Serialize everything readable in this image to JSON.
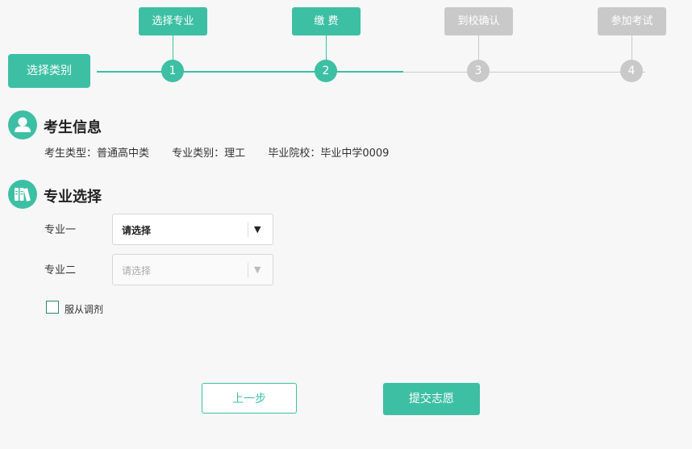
{
  "stepper": {
    "start_label": "选择类别",
    "steps": [
      {
        "label": "选择专业",
        "number": "1",
        "state": "active"
      },
      {
        "label": "缴 费",
        "number": "2",
        "state": "active"
      },
      {
        "label": "到校确认",
        "number": "3",
        "state": "inactive"
      },
      {
        "label": "参加考试",
        "number": "4",
        "state": "inactive"
      }
    ]
  },
  "student_info": {
    "title": "考生信息",
    "icon": "user-icon",
    "items": [
      "考生类型：普通高中类",
      "专业类别：理工",
      "毕业院校：毕业中学0009"
    ]
  },
  "major_selection": {
    "title": "专业选择",
    "icon": "books-icon",
    "first": {
      "label": "专业一",
      "placeholder": "请选择",
      "enabled": true
    },
    "second": {
      "label": "专业二",
      "placeholder": "请选择",
      "enabled": false
    },
    "adjust_label": "服从调剂"
  },
  "buttons": {
    "prev": "上一步",
    "submit": "提交志愿"
  },
  "colors": {
    "accent": "#3dbfa3",
    "inactive": "#c9c9c9",
    "background": "#f7f7f7"
  }
}
